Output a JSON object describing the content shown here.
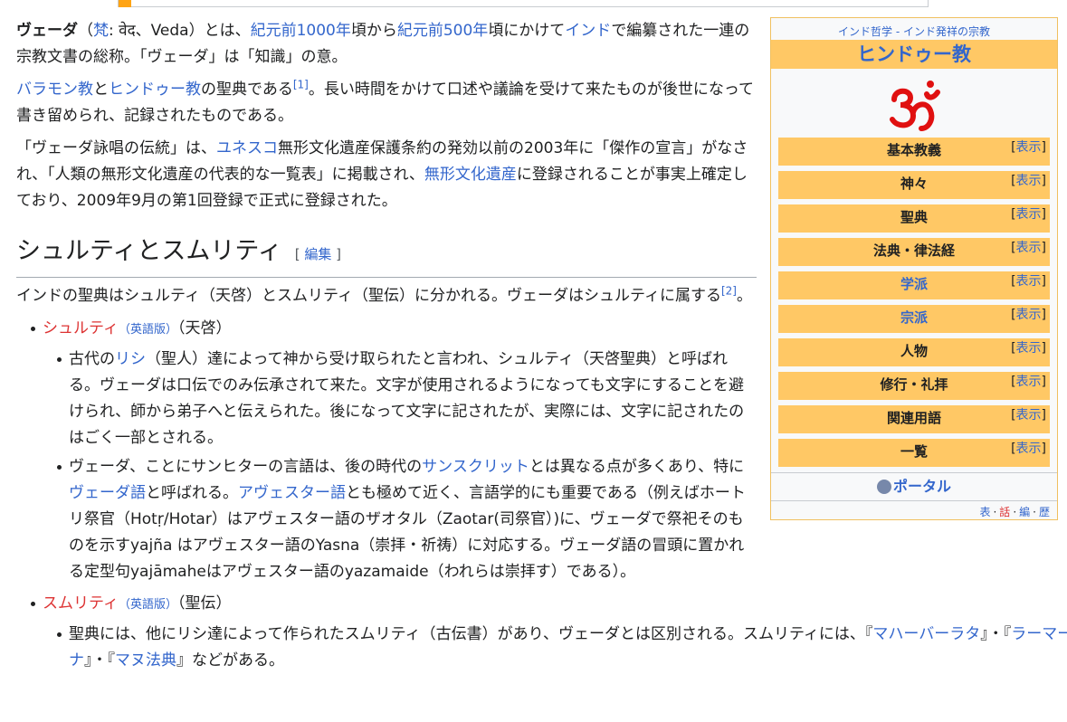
{
  "intro": {
    "p1_bold": "ヴェーダ",
    "p1_open": "（",
    "p1_fan_link": "梵",
    "p1_fan_rest": ": वेद、Veda）とは、",
    "p1_link_bc1000": "紀元前1000年",
    "p1_t1": "頃から",
    "p1_link_bc500": "紀元前500年",
    "p1_t2": "頃にかけて",
    "p1_link_india": "インド",
    "p1_t3": "で編纂された一連の宗教文書の総称。「ヴェーダ」は「知識」の意。",
    "p2_link_brahmin": "バラモン教",
    "p2_t1": "と",
    "p2_link_hindu": "ヒンドゥー教",
    "p2_t2": "の聖典である",
    "p2_ref": "[1]",
    "p2_t3": "。長い時間をかけて口述や議論を受けて来たものが後世になって書き留められ、記録されたものである。",
    "p3_t1": "「ヴェーダ詠唱の伝統」は、",
    "p3_link_unesco": "ユネスコ",
    "p3_t2": "無形文化遺産保護条約の発効以前の2003年に「傑作の宣言」がなされ、「人類の無形文化遺産の代表的な一覧表」に掲載され、",
    "p3_link_ich": "無形文化遺産",
    "p3_t3": "に登録されることが事実上確定しており、2009年9月の第1回登録で正式に登録された。"
  },
  "section": {
    "heading": "シュルティとスムリティ",
    "edit_open": "[ ",
    "edit_label": "編集",
    "edit_close": " ]",
    "p_t1": "インドの聖典はシュルティ（天啓）とスムリティ（聖伝）に分かれる。ヴェーダはシュルティに属する",
    "p_ref": "[2]",
    "p_t2": "。"
  },
  "list": {
    "shruti_link": "シュルティ",
    "shruti_en": "（英語版）",
    "shruti_note": "（天啓）",
    "s1_t1": "古代の",
    "s1_link_rishi": "リシ",
    "s1_t2": "（聖人）達によって神から受け取られたと言われ、シュルティ（天啓聖典）と呼ばれる。ヴェーダは口伝でのみ伝承されて来た。文字が使用されるようになっても文字にすることを避けられ、師から弟子へと伝えられた。後になって文字に記されたが、実際には、文字に記されたのはごく一部とされる。",
    "s2_t1": "ヴェーダ、ことにサンヒターの言語は、後の時代の",
    "s2_link_sanskrit": "サンスクリット",
    "s2_t2": "とは異なる点が多くあり、特に",
    "s2_link_vedic": "ヴェーダ語",
    "s2_t3": "と呼ばれる。",
    "s2_link_avestan": "アヴェスター語",
    "s2_t4": "とも極めて近く、言語学的にも重要である（例えばホートリ祭官（Hotṛ/Hotar）はアヴェスター語のザオタル（Zaotar(司祭官）)に、ヴェーダで祭祀そのものを示すyajña はアヴェスター語のYasna（崇拝・祈祷）に対応する。ヴェーダ語の冒頭に置かれる定型句yajāmaheはアヴェスター語のyazamaide（われらは崇拝す）である）。",
    "smriti_link": "スムリティ",
    "smriti_en": "（英語版）",
    "smriti_note": "（聖伝）",
    "m1_t1": "聖典には、他にリシ達によって作られたスムリティ（古伝書）があり、ヴェーダとは区別される。スムリティには、『",
    "m1_link_mahabharata": "マハーバーラタ",
    "m1_t2": "』・『",
    "m1_link_ramayana": "ラーマーヤナ",
    "m1_t3": "』・『",
    "m1_link_manu": "マヌ法典",
    "m1_t4": "』などがある。"
  },
  "infobox": {
    "subtitle": "インド哲学 - インド発祥の宗教",
    "title": "ヒンドゥー教",
    "symbol_icon": "om-symbol",
    "show_label": "表示",
    "rows": [
      {
        "label": "基本教義",
        "link": false
      },
      {
        "label": "神々",
        "link": false
      },
      {
        "label": "聖典",
        "link": false
      },
      {
        "label": "法典・律法経",
        "link": false
      },
      {
        "label": "学派",
        "link": true
      },
      {
        "label": "宗派",
        "link": true
      },
      {
        "label": "人物",
        "link": false
      },
      {
        "label": "修行・礼拝",
        "link": false
      },
      {
        "label": "関連用語",
        "link": false
      },
      {
        "label": "一覧",
        "link": false
      }
    ],
    "portal": "ポータル",
    "nav": [
      "表",
      "話",
      "編",
      "歴"
    ]
  },
  "colors": {
    "link": "#3366cc",
    "redlink": "#dd3333",
    "box_header": "#ffc865",
    "om": "#e01010"
  }
}
